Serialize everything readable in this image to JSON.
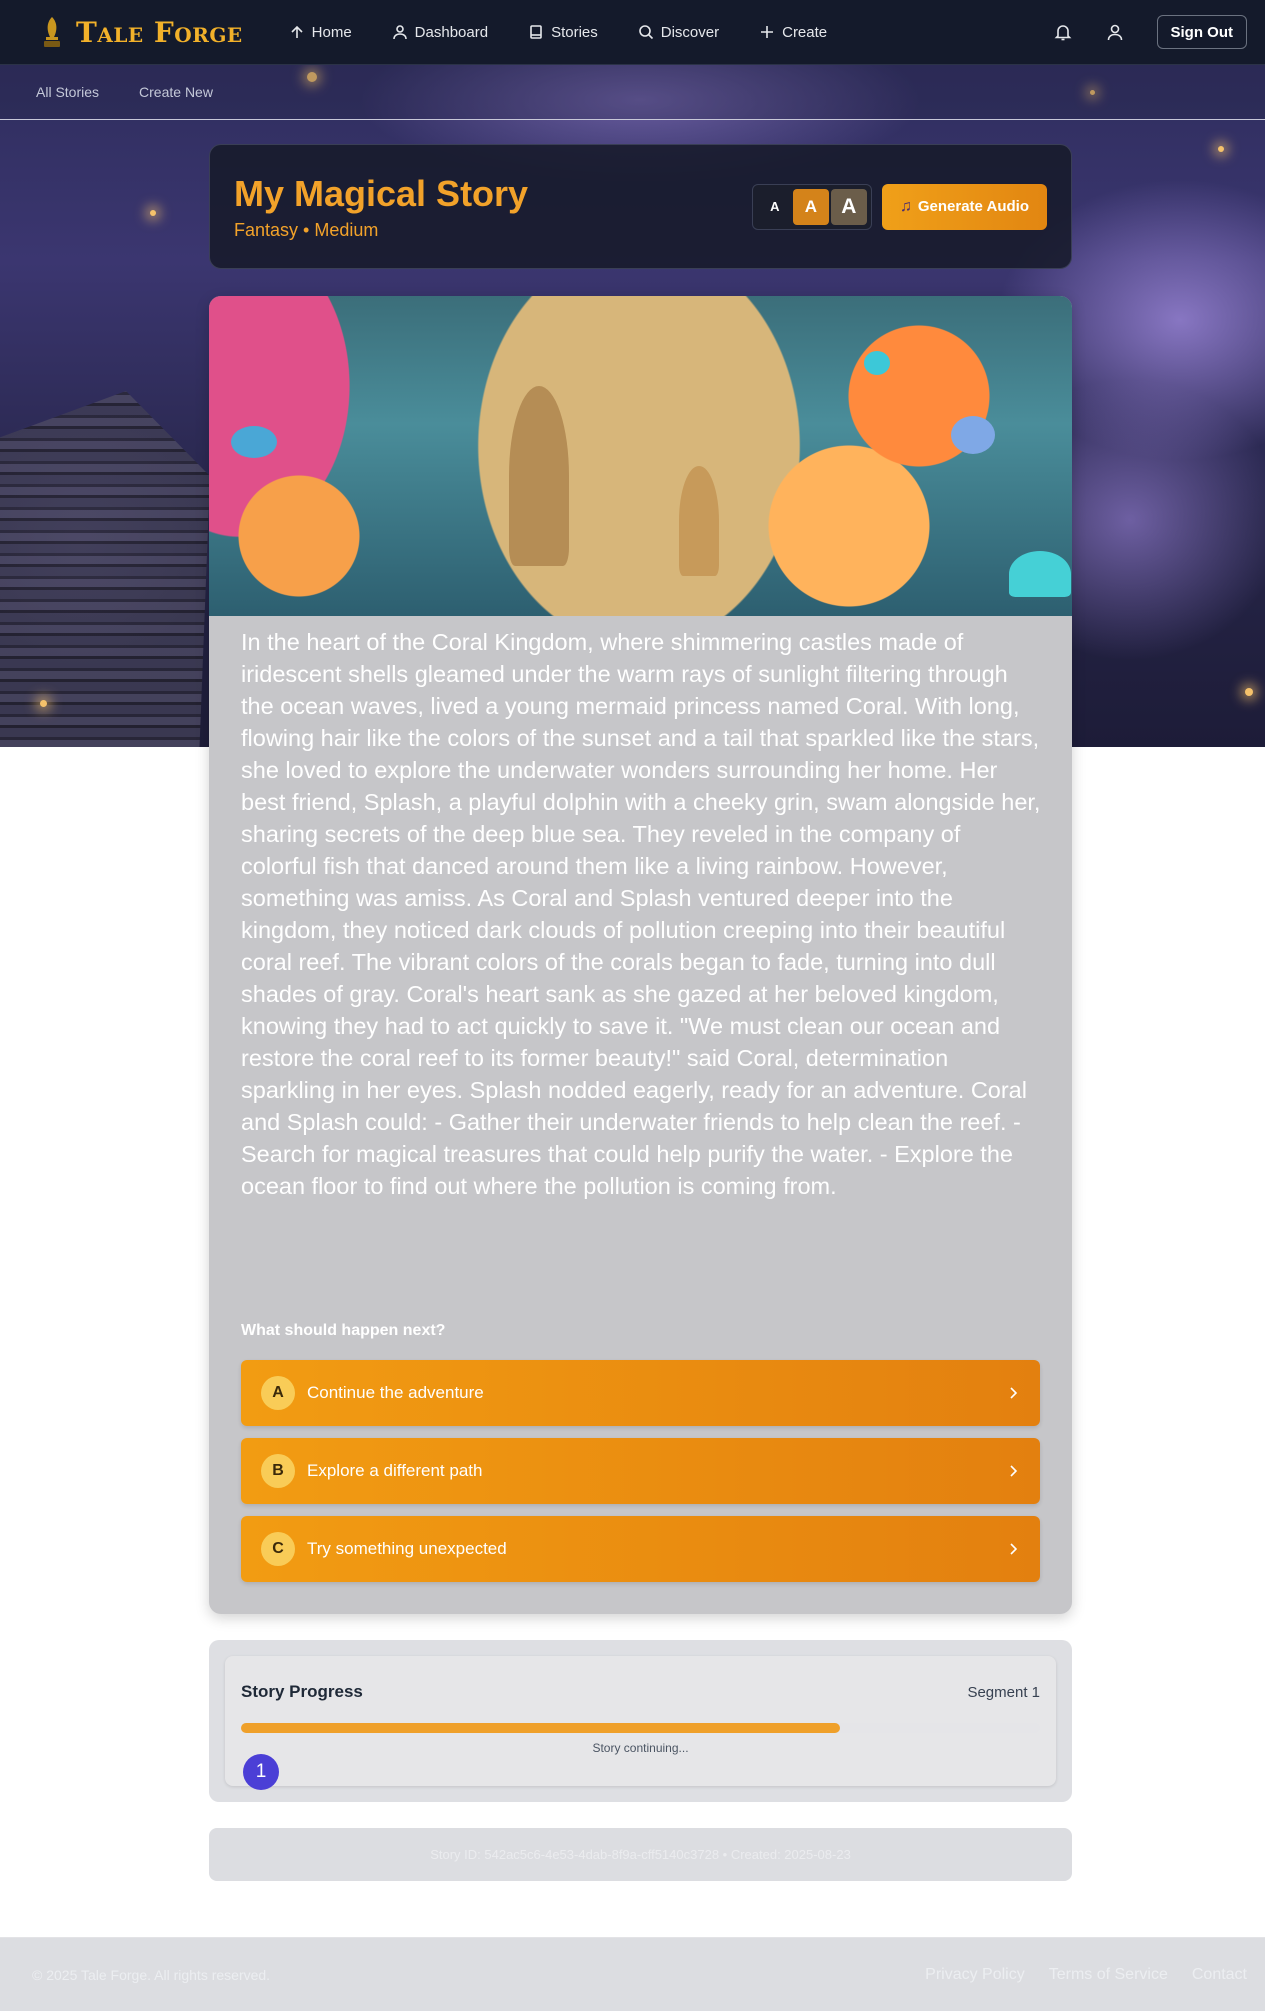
{
  "brand": {
    "name": "Tale Forge",
    "icon": "quill-icon"
  },
  "nav": {
    "items": [
      {
        "label": "Home",
        "icon": "home-icon"
      },
      {
        "label": "Dashboard",
        "icon": "user-icon"
      },
      {
        "label": "Stories",
        "icon": "book-icon"
      },
      {
        "label": "Discover",
        "icon": "search-icon"
      },
      {
        "label": "Create",
        "icon": "plus-icon"
      }
    ],
    "sign_out": "Sign Out"
  },
  "subnav": {
    "items": [
      "All Stories",
      "Create New"
    ]
  },
  "story": {
    "title": "My Magical Story",
    "genre": "Fantasy",
    "separator": "•",
    "length": "Medium",
    "font_size_options": [
      "A",
      "A",
      "A"
    ],
    "selected_font_size": "medium",
    "generate_audio": "Generate Audio",
    "text": "In the heart of the Coral Kingdom, where shimmering castles made of iridescent shells gleamed under the warm rays of sunlight filtering through the ocean waves, lived a young mermaid princess named Coral. With long, flowing hair like the colors of the sunset and a tail that sparkled like the stars, she loved to explore the underwater wonders surrounding her home. Her best friend, Splash, a playful dolphin with a cheeky grin, swam alongside her, sharing secrets of the deep blue sea. They reveled in the company of colorful fish that danced around them like a living rainbow. However, something was amiss. As Coral and Splash ventured deeper into the kingdom, they noticed dark clouds of pollution creeping into their beautiful coral reef. The vibrant colors of the corals began to fade, turning into dull shades of gray. Coral's heart sank as she gazed at her beloved kingdom, knowing they had to act quickly to save it. \"We must clean our ocean and restore the coral reef to its former beauty!\" said Coral, determination sparkling in her eyes. Splash nodded eagerly, ready for an adventure. Coral and Splash could: - Gather their underwater friends to help clean the reef. - Search for magical treasures that could help purify the water. - Explore the ocean floor to find out where the pollution is coming from.",
    "choices_heading": "What should happen next?",
    "choices": [
      {
        "letter": "A",
        "label": "Continue the adventure"
      },
      {
        "letter": "B",
        "label": "Explore a different path"
      },
      {
        "letter": "C",
        "label": "Try something unexpected"
      }
    ]
  },
  "progress": {
    "title": "Story Progress",
    "segment_label": "Segment 1",
    "fraction": 0.75,
    "status": "Story continuing...",
    "segments": [
      "1"
    ]
  },
  "meta": {
    "text": "Story ID: 542ac5c6-4e53-4dab-8f9a-cff5140c3728 • Created: 2025-08-23"
  },
  "footer": {
    "copyright": "© 2025 Tale Forge. All rights reserved.",
    "links": [
      "Privacy Policy",
      "Terms of Service",
      "Contact"
    ]
  },
  "colors": {
    "accent": "#f2a22a",
    "navbar": "#141a2b",
    "choice": "#ee9212",
    "segment": "#4b3fd6"
  }
}
